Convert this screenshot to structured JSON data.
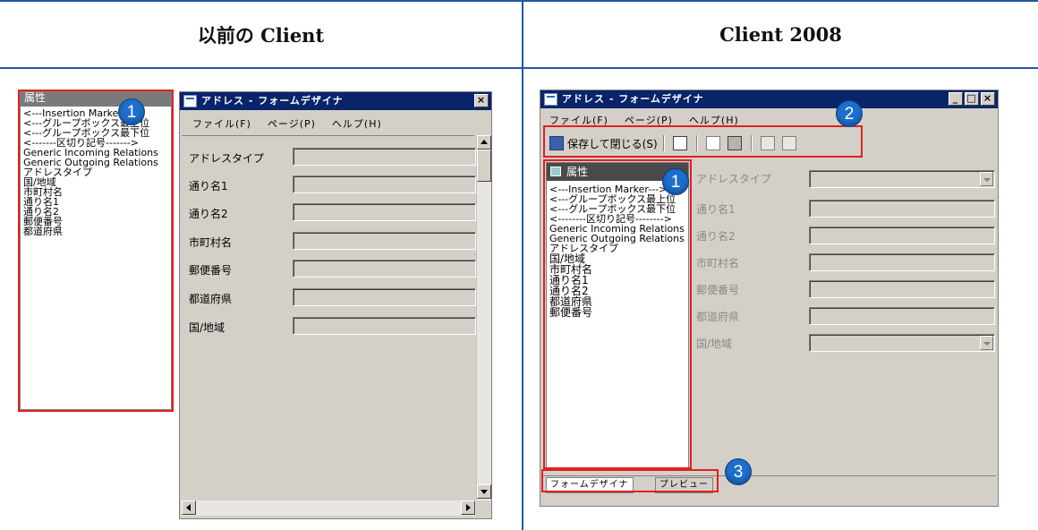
{
  "header": {
    "left_title": "以前の Client",
    "right_title": "Client 2008"
  },
  "old_window": {
    "title": "アドレス - フォームデザイナ",
    "close_glyph": "×",
    "menu": [
      "ファイル(F)",
      "ページ(P)",
      "ヘルプ(H)"
    ],
    "properties_title": "属性",
    "properties": [
      "<---Insertion Marker--->",
      "<---グループボックス最上位",
      "<---グループボックス最下位",
      "<-------区切り記号------->",
      "Generic Incoming Relations",
      "Generic Outgoing Relations",
      "アドレスタイプ",
      "国/地域",
      "市町村名",
      "通り名1",
      "通り名2",
      "郵便番号",
      "都道府県"
    ],
    "fields": [
      "アドレスタイプ",
      "通り名1",
      "通り名2",
      "市町村名",
      "郵便番号",
      "都道府県",
      "国/地域"
    ],
    "badge": "1"
  },
  "new_window": {
    "title": "アドレス - フォームデザイナ",
    "window_buttons": [
      "_",
      "□",
      "×"
    ],
    "menu": [
      "ファイル(F)",
      "ページ(P)",
      "ヘルプ(H)"
    ],
    "save_close_label": "保存して閉じる(S)",
    "properties_title": "属性",
    "properties": [
      "<---Insertion Marker--->",
      "<---グループボックス最上位",
      "<---グループボックス最下位",
      "<--------区切り記号-------->",
      "Generic Incoming Relations",
      "Generic Outgoing Relations",
      "アドレスタイプ",
      "国/地域",
      "市町村名",
      "通り名1",
      "通り名2",
      "都道府県",
      "郵便番号"
    ],
    "fields": [
      "アドレスタイプ",
      "通り名1",
      "通り名2",
      "市町村名",
      "郵便番号",
      "都道府県",
      "国/地域"
    ],
    "tabs": [
      "フォームデザイナ",
      "プレビュー"
    ],
    "badges": [
      "1",
      "2",
      "3"
    ]
  },
  "colors": {
    "rule": "#23589a",
    "highlight_box": "#e02020",
    "badge": "#1d6fcc",
    "titlebar": "#0a246a"
  }
}
